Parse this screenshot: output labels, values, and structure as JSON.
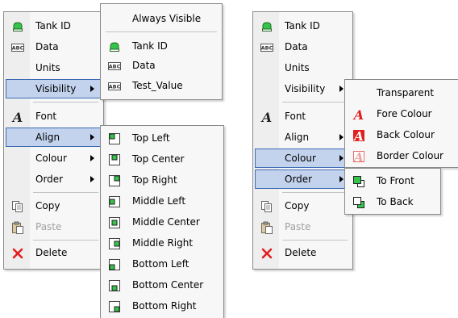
{
  "left": {
    "menu": [
      "Tank ID",
      "Data",
      "Units",
      "Visibility",
      "Font",
      "Align",
      "Colour",
      "Order",
      "Copy",
      "Paste",
      "Delete"
    ],
    "visibility_submenu": [
      "Always Visible",
      "Tank ID",
      "Data",
      "Test_Value"
    ],
    "align_submenu": [
      "Top Left",
      "Top Center",
      "Top Right",
      "Middle Left",
      "Middle Center",
      "Middle Right",
      "Bottom Left",
      "Bottom Center",
      "Bottom Right"
    ]
  },
  "right": {
    "menu": [
      "Tank ID",
      "Data",
      "Units",
      "Visibility",
      "Font",
      "Align",
      "Colour",
      "Order",
      "Copy",
      "Paste",
      "Delete"
    ],
    "colour_submenu": [
      "Transparent",
      "Fore Colour",
      "Back Colour",
      "Border Colour"
    ],
    "order_submenu": [
      "To Front",
      "To Back"
    ]
  },
  "colors": {
    "highlight_bg": "#c3d3ee",
    "highlight_border": "#3c6bb4",
    "tank_green": "#35c44a",
    "red": "#e02020"
  }
}
